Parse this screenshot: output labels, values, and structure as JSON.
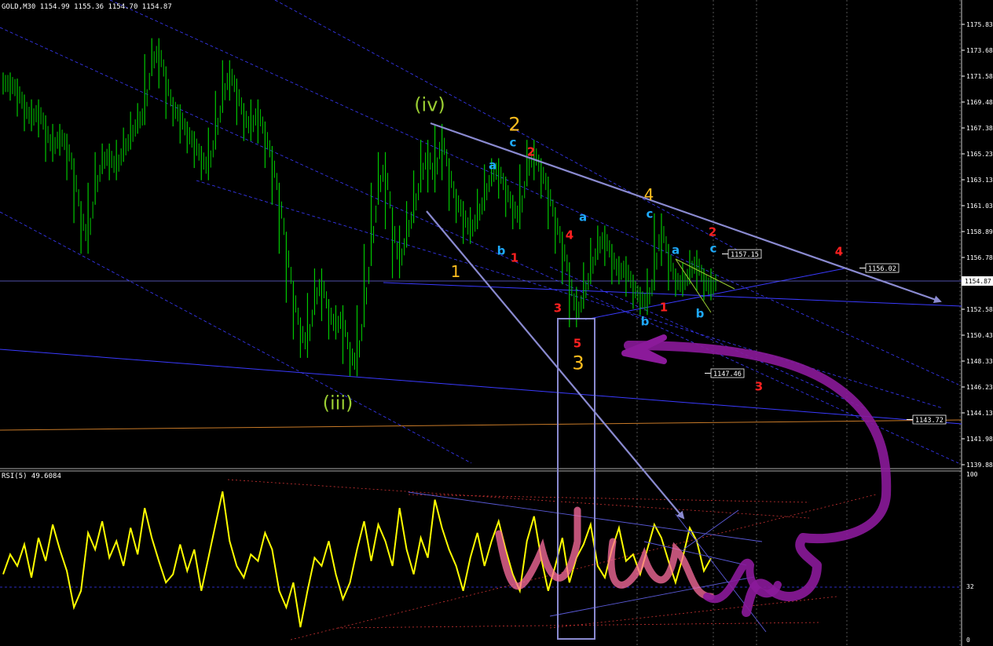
{
  "header": {
    "price_title": "GOLD,M30  1154.99 1155.36 1154.70 1154.87",
    "rsi_title": "RSI(5) 49.6084"
  },
  "colors": {
    "background": "#000000",
    "candle": "#00c800",
    "rsi": "#ffff00",
    "trend_line": "#8a8ad0",
    "channel_dash": "#3a3aff",
    "support_orange": "#c87a28",
    "annotation_purple": "#8b1a9a",
    "annotation_pink": "#ff6fa0",
    "grid": "#8a8a8a",
    "green_label": "#9acd32",
    "orange_label": "#ffbe1e",
    "cyan_label": "#1eaaff",
    "red_label": "#ff2020"
  },
  "price_axis": {
    "ticks": [
      "1175.83",
      "1173.68",
      "1171.58",
      "1169.48",
      "1167.38",
      "1165.23",
      "1163.13",
      "1161.03",
      "1158.89",
      "1156.78",
      "1154.68",
      "1152.58",
      "1150.43",
      "1148.33",
      "1146.23",
      "1144.13",
      "1141.98",
      "1139.88"
    ],
    "current": "1154.87"
  },
  "rsi_axis": {
    "ticks": [
      "100",
      "32",
      "0"
    ]
  },
  "price_tags": [
    {
      "text": "1157.15",
      "color": "#ffffff"
    },
    {
      "text": "1156.02",
      "color": "#ffffff"
    },
    {
      "text": "1147.46",
      "color": "#ffffff"
    },
    {
      "text": "1143.72",
      "color": "#ffffff"
    }
  ],
  "wave_labels": [
    {
      "text": "(iv)",
      "color": "#9acd32",
      "size": "big"
    },
    {
      "text": "(iii)",
      "color": "#9acd32",
      "size": "big"
    },
    {
      "text": "2",
      "color": "#ffbe1e",
      "size": "big"
    },
    {
      "text": "c",
      "color": "#1eaaff",
      "size": "small"
    },
    {
      "text": "2",
      "color": "#ff2020",
      "size": "small"
    },
    {
      "text": "a",
      "color": "#1eaaff",
      "size": "small"
    },
    {
      "text": "1",
      "color": "#ffbe1e",
      "size": "mid"
    },
    {
      "text": "b",
      "color": "#1eaaff",
      "size": "small"
    },
    {
      "text": "1",
      "color": "#ff2020",
      "size": "small"
    },
    {
      "text": "4",
      "color": "#ff2020",
      "size": "small"
    },
    {
      "text": "3",
      "color": "#ff2020",
      "size": "small"
    },
    {
      "text": "a",
      "color": "#1eaaff",
      "size": "small"
    },
    {
      "text": "5",
      "color": "#ff2020",
      "size": "small"
    },
    {
      "text": "3",
      "color": "#ffbe1e",
      "size": "big"
    },
    {
      "text": "4",
      "color": "#ffbe1e",
      "size": "mid"
    },
    {
      "text": "c",
      "color": "#1eaaff",
      "size": "small"
    },
    {
      "text": "b",
      "color": "#1eaaff",
      "size": "small"
    },
    {
      "text": "1",
      "color": "#ff2020",
      "size": "small"
    },
    {
      "text": "a",
      "color": "#1eaaff",
      "size": "small"
    },
    {
      "text": "b",
      "color": "#1eaaff",
      "size": "small"
    },
    {
      "text": "2",
      "color": "#ff2020",
      "size": "small"
    },
    {
      "text": "c",
      "color": "#1eaaff",
      "size": "small"
    },
    {
      "text": "3",
      "color": "#ff2020",
      "size": "small"
    },
    {
      "text": "4",
      "color": "#ff2020",
      "size": "small"
    }
  ],
  "chart_data": {
    "type": "candlestick",
    "symbol": "GOLD",
    "timeframe": "M30",
    "ohlc": {
      "open": 1154.99,
      "high": 1155.36,
      "low": 1154.7,
      "close": 1154.87
    },
    "price_range": [
      1139.88,
      1175.83
    ],
    "close_series": [
      1171.0,
      1170.5,
      1169.2,
      1168.0,
      1168.8,
      1167.5,
      1165.5,
      1166.8,
      1166.0,
      1164.0,
      1160.5,
      1158.0,
      1162.0,
      1164.5,
      1165.2,
      1164.0,
      1165.5,
      1166.5,
      1167.8,
      1168.5,
      1172.5,
      1173.8,
      1171.5,
      1169.0,
      1168.4,
      1167.0,
      1166.2,
      1165.0,
      1164.0,
      1166.5,
      1169.5,
      1172.0,
      1170.5,
      1168.5,
      1167.2,
      1168.8,
      1167.0,
      1165.0,
      1162.0,
      1158.0,
      1154.0,
      1151.0,
      1149.5,
      1153.0,
      1155.0,
      1152.5,
      1151.0,
      1152.0,
      1149.0,
      1148.0,
      1152.0,
      1157.0,
      1162.0,
      1164.5,
      1160.0,
      1156.0,
      1158.5,
      1160.5,
      1163.0,
      1165.5,
      1163.0,
      1166.8,
      1164.0,
      1161.5,
      1160.5,
      1158.8,
      1160.0,
      1161.5,
      1163.5,
      1164.0,
      1162.5,
      1161.0,
      1160.0,
      1163.5,
      1165.5,
      1164.0,
      1162.5,
      1160.0,
      1158.0,
      1155.5,
      1152.0,
      1153.5,
      1155.5,
      1157.5,
      1158.5,
      1157.0,
      1155.5,
      1156.0,
      1154.5,
      1153.5,
      1153.0,
      1155.0,
      1159.5,
      1157.0,
      1155.0,
      1154.5,
      1155.5,
      1156.5,
      1155.0,
      1154.2,
      1155.0
    ],
    "rsi": {
      "period": 5,
      "current": 49.6084,
      "range": [
        0,
        100
      ],
      "level": 32,
      "values": [
        40,
        52,
        45,
        58,
        38,
        62,
        48,
        70,
        55,
        42,
        20,
        30,
        65,
        55,
        72,
        50,
        60,
        45,
        68,
        52,
        80,
        62,
        48,
        35,
        40,
        58,
        42,
        55,
        30,
        50,
        70,
        90,
        60,
        45,
        38,
        52,
        48,
        65,
        55,
        30,
        20,
        35,
        8,
        30,
        50,
        45,
        60,
        40,
        25,
        35,
        55,
        72,
        48,
        70,
        60,
        45,
        80,
        55,
        40,
        62,
        50,
        85,
        68,
        55,
        45,
        30,
        50,
        65,
        45,
        60,
        72,
        55,
        40,
        30,
        60,
        75,
        50,
        30,
        45,
        62,
        35,
        50,
        58,
        70,
        45,
        38,
        55,
        68,
        48,
        52,
        40,
        55,
        70,
        62,
        48,
        35,
        50,
        68,
        60,
        42,
        49.6
      ]
    }
  }
}
